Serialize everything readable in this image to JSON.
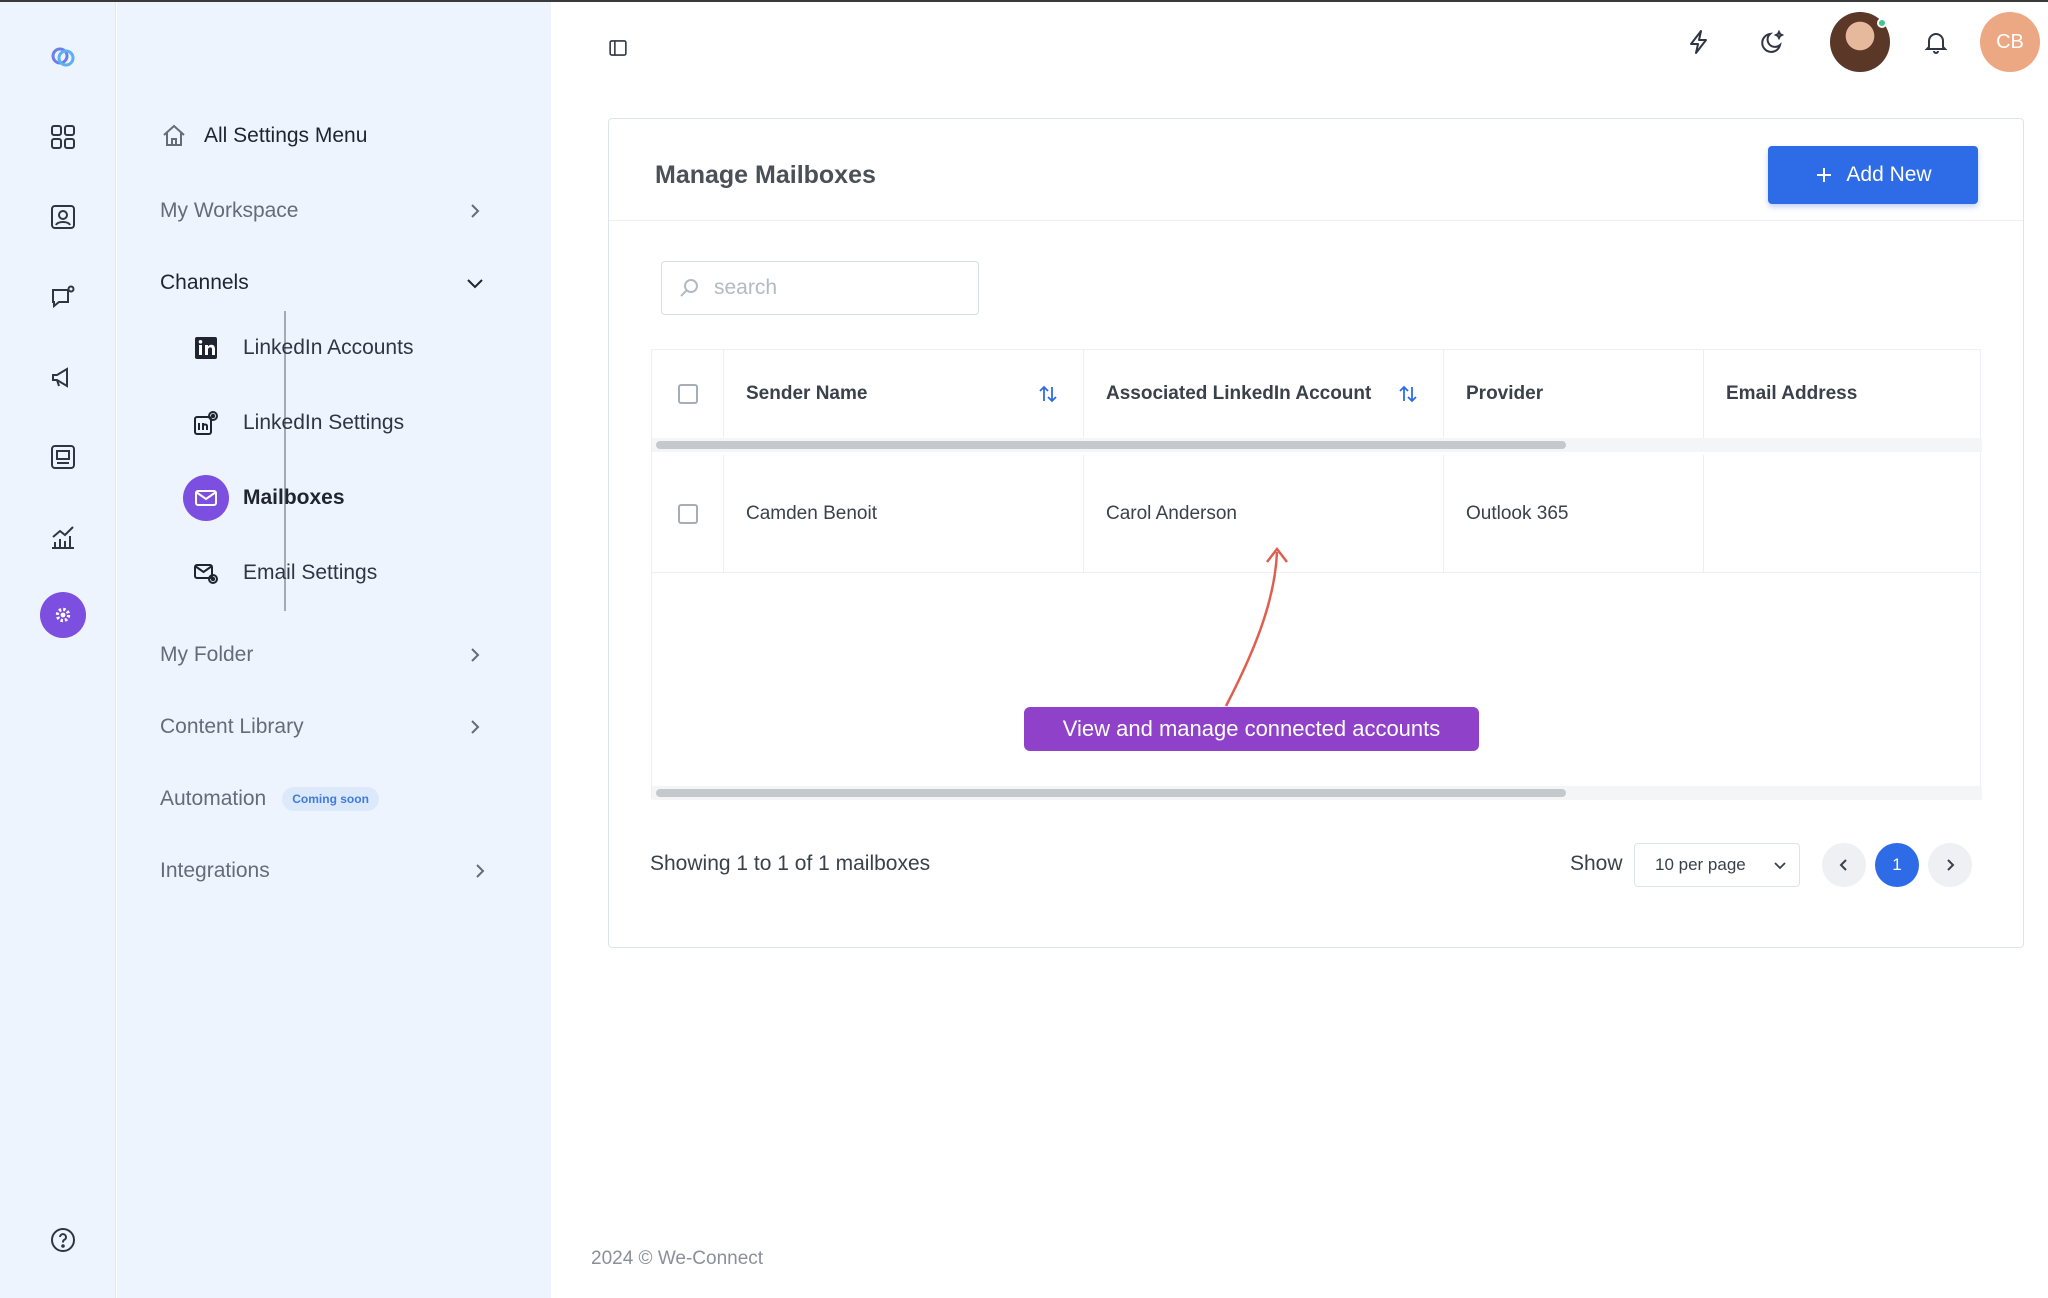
{
  "rail": {
    "icons": [
      "logo-icon",
      "dashboard-icon",
      "contacts-icon",
      "messages-icon",
      "campaign-megaphone-icon",
      "inbox-icon",
      "analytics-icon",
      "settings-icon",
      "help-icon"
    ]
  },
  "menu": {
    "all_settings": "All Settings Menu",
    "my_workspace": "My Workspace",
    "channels": "Channels",
    "channel_items": {
      "linkedin_accounts": "LinkedIn Accounts",
      "linkedin_settings": "LinkedIn Settings",
      "mailboxes": "Mailboxes",
      "email_settings": "Email Settings"
    },
    "my_folder": "My Folder",
    "content_library": "Content Library",
    "automation": "Automation",
    "automation_badge": "Coming soon",
    "integrations": "Integrations"
  },
  "topbar": {
    "icons": [
      "sidebar-toggle-icon",
      "lightning-icon",
      "theme-moon-icon",
      "bell-icon"
    ],
    "user_initials": "CB"
  },
  "card": {
    "title": "Manage Mailboxes",
    "add_button": "Add New",
    "search_placeholder": "search"
  },
  "table": {
    "columns": [
      "Sender Name",
      "Associated LinkedIn Account",
      "Provider",
      "Email Address"
    ],
    "rows": [
      {
        "sender_name": "Camden Benoit",
        "linkedin_account": "Carol Anderson",
        "provider": "Outlook 365",
        "email": ""
      }
    ]
  },
  "callout": "View and manage connected accounts",
  "pagination": {
    "showing": "Showing 1 to 1 of 1 mailboxes",
    "show_label": "Show",
    "per_page": "10 per page",
    "current_page": "1"
  },
  "footer": {
    "copyright": "2024 © We-Connect"
  },
  "colors": {
    "accent_purple": "#7c4fe0",
    "primary_blue": "#2e6be6",
    "callout": "#8f42c9",
    "avatar": "#eca882"
  }
}
